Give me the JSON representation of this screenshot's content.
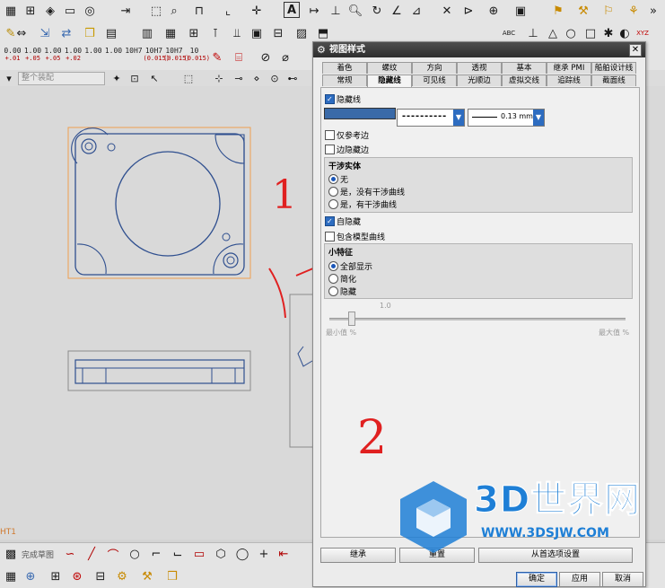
{
  "toolbar": {
    "row3_numbers": [
      {
        "top": "0.00",
        "bottom": "+.01"
      },
      {
        "top": "1.00",
        "bottom": "+.05"
      },
      {
        "top": "1.00",
        "bottom": "+.05"
      },
      {
        "top": "1.00",
        "bottom": "+.02"
      },
      {
        "top": "1.00",
        "bottom": ""
      },
      {
        "top": "1.00",
        "bottom": ""
      },
      {
        "top": "10H7",
        "bottom": ""
      },
      {
        "top": "10H7",
        "bottom": "(0.015)"
      },
      {
        "top": "10H7",
        "bottom": "(0.015)"
      },
      {
        "top": "10",
        "bottom": "(0.015)"
      }
    ],
    "selection_filter": "整个装配",
    "text_tool_label": "ABC",
    "axis_label": "XYZ"
  },
  "sketch_bar": {
    "label": "完成草图",
    "sheet_label": "HT1"
  },
  "dialog": {
    "title": "视图样式",
    "tabs_row1": [
      "着色",
      "螺纹",
      "方向",
      "透视",
      "基本",
      "继承 PMI",
      "船舶设计线"
    ],
    "tabs_row2": [
      "常规",
      "隐藏线",
      "可见线",
      "光顺边",
      "虚拟交线",
      "追踪线",
      "截面线"
    ],
    "active_tab": "隐藏线",
    "hidden_lines_label": "隐藏线",
    "hidden_lines_checked": true,
    "line_color": "#3a6aa8",
    "line_style_value": "----------",
    "line_width_value": "0.13 mm",
    "ref_edges_only_label": "仅参考边",
    "ref_edges_only_checked": false,
    "edges_hidden_label": "边隐藏边",
    "edges_hidden_checked": false,
    "interference_group": {
      "title": "干涉实体",
      "options": [
        "无",
        "是，没有干涉曲线",
        "是，有干涉曲线"
      ],
      "selected": 0
    },
    "self_hidden_label": "自隐藏",
    "self_hidden_checked": true,
    "include_model_curves_label": "包含模型曲线",
    "include_model_curves_checked": false,
    "small_features_group": {
      "title": "小特征",
      "options": [
        "全部显示",
        "简化",
        "隐藏"
      ],
      "selected": 0
    },
    "slider": {
      "value_label": "1.0",
      "min_label": "最小值 %",
      "max_label": "最大值 %",
      "position": 0.25
    },
    "inherit_button": "继承",
    "reset_button": "重置",
    "settings_text": "从首选项设置",
    "ok_button": "确定",
    "apply_button": "应用",
    "cancel_button": "取消"
  },
  "annotations": {
    "one": "1",
    "two": "2",
    "color": "#e02020"
  },
  "watermark": {
    "text": "3D世界网",
    "url": "WWW.3DSJW.COM",
    "color": "#1e7fd6"
  }
}
